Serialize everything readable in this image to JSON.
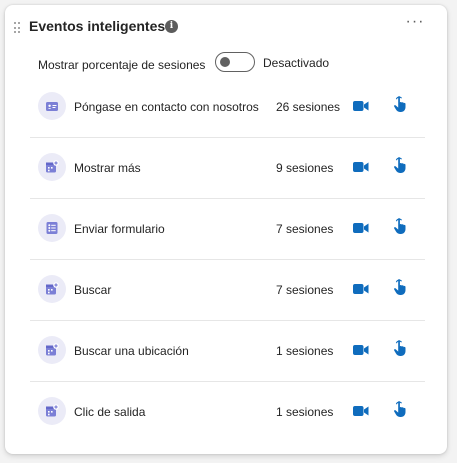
{
  "header": {
    "title": "Eventos inteligentes",
    "info_icon": "info-icon",
    "more_label": "···"
  },
  "toggle": {
    "label": "Mostrar porcentaje de sesiones",
    "state": "Desactivado",
    "on": false
  },
  "colors": {
    "accent": "#0f6cbd",
    "icon_bg": "#ebebf7",
    "icon_fg": "#7b7fd6"
  },
  "events": [
    {
      "name": "Póngase en contacto con nosotros",
      "sessions": "26 sesiones",
      "icon": "contact-card-icon"
    },
    {
      "name": "Mostrar más",
      "sessions": "9 sesiones",
      "icon": "calendar-add-icon"
    },
    {
      "name": "Enviar formulario",
      "sessions": "7 sesiones",
      "icon": "form-icon"
    },
    {
      "name": "Buscar",
      "sessions": "7 sesiones",
      "icon": "calendar-add-icon"
    },
    {
      "name": "Buscar una ubicación",
      "sessions": "1 sesiones",
      "icon": "calendar-add-icon"
    },
    {
      "name": "Clic de salida",
      "sessions": "1 sesiones",
      "icon": "calendar-add-icon"
    }
  ]
}
